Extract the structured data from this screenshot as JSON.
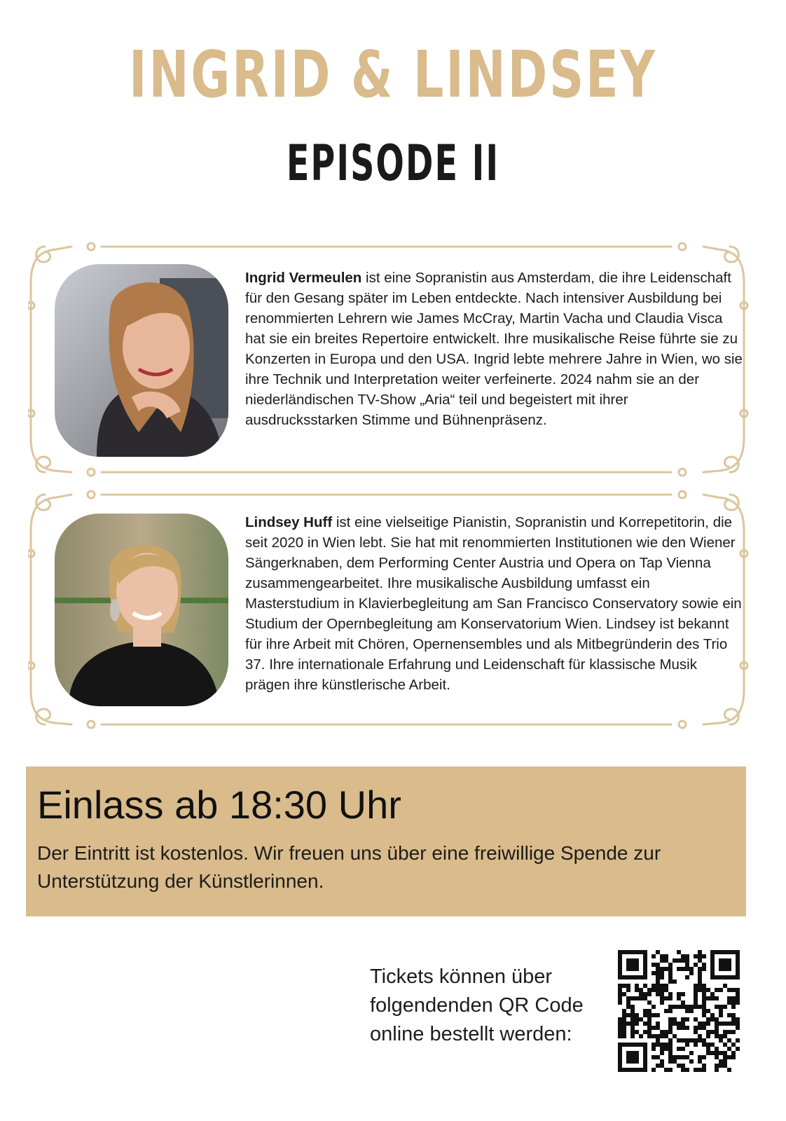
{
  "colors": {
    "gold": "#d9bb8c",
    "ornament": "#dcc59e",
    "text": "#1a1a1a"
  },
  "header": {
    "title": "INGRID & LINDSEY",
    "subtitle": "EPISODE II"
  },
  "bios": [
    {
      "photo": "portrait-ingrid-vermeulen",
      "name": "Ingrid Vermeulen",
      "text": " ist eine Sopranistin aus Amsterdam, die ihre Leidenschaft für den Gesang später im Leben entdeckte. Nach intensiver Ausbildung bei renommierten Lehrern wie James McCray, Martin Vacha und Claudia Visca hat sie ein breites Repertoire entwickelt. Ihre musikalische Reise führte sie zu Konzerten in Europa und den USA. Ingrid lebte mehrere Jahre in Wien, wo sie ihre Technik und Interpretation weiter verfeinerte. 2024 nahm sie an der niederländischen TV-Show „Aria“ teil und begeistert mit ihrer ausdrucksstarken Stimme und Bühnenpräsenz."
    },
    {
      "photo": "portrait-lindsey-huff",
      "name": "Lindsey Huff",
      "text": " ist eine vielseitige Pianistin, Sopranistin und Korrepetitorin, die seit 2020 in Wien lebt. Sie hat mit renommierten Institutionen wie den Wiener Sängerknaben, dem Performing Center Austria und Opera on Tap Vienna zusammengearbeitet. Ihre musikalische Ausbildung umfasst ein Masterstudium in Klavierbegleitung am San Francisco Conservatory sowie ein Studium der Opernbegleitung am Konservatorium Wien. Lindsey ist bekannt für ihre Arbeit mit Chören, Opernensembles und als Mitbegründerin des Trio 37. Ihre internationale Erfahrung und Leidenschaft für klassische Musik prägen ihre künstlerische Arbeit."
    }
  ],
  "info": {
    "heading": "Einlass ab 18:30 Uhr",
    "text": "Der Eintritt ist kostenlos. Wir freuen uns über eine freiwillige Spende zur Unterstützung der Künstlerinnen."
  },
  "tickets": {
    "text": "Tickets können über folgendenden QR Code online bestellt werden:",
    "qr_icon": "qr-code"
  }
}
